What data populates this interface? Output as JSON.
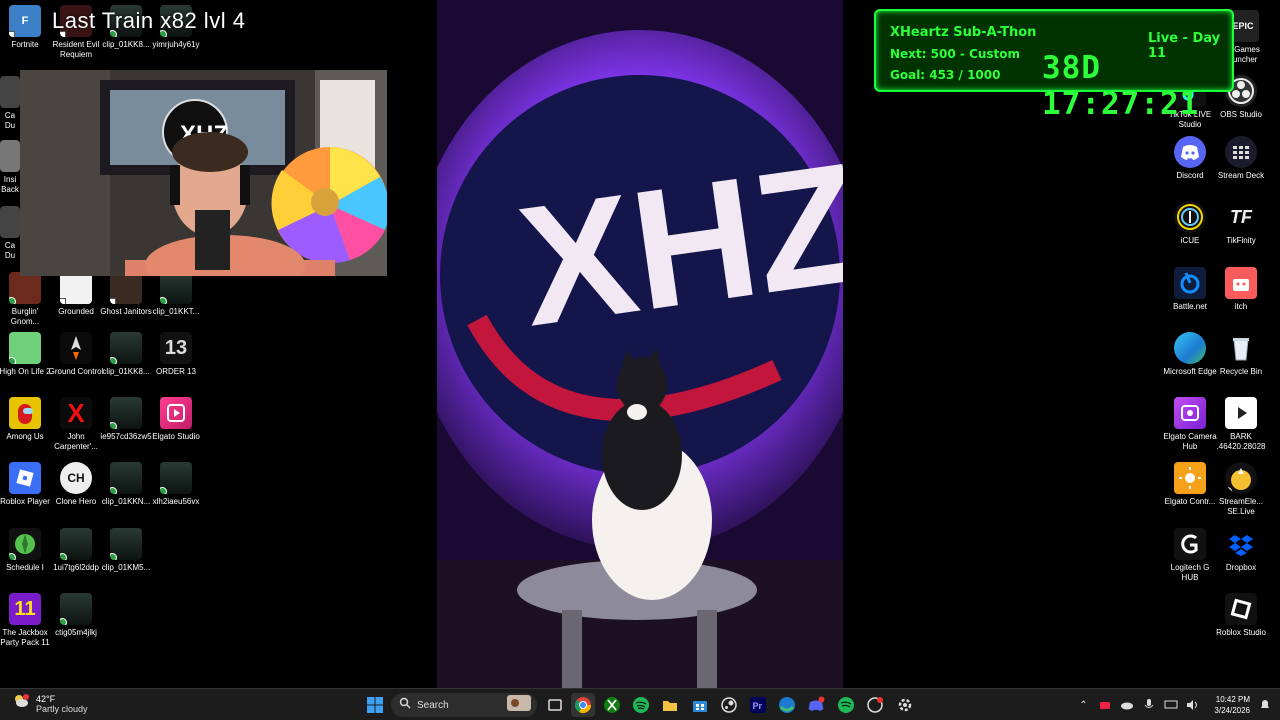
{
  "overlay": {
    "game_title": "Last Train   x82   lvl 4"
  },
  "subathon": {
    "title": "XHeartz Sub-A-Thon",
    "next": "Next: 500 - Custom Hea",
    "goal": "Goal: 453 / 1000",
    "day": "Live - Day 11",
    "timer": "38D  17:27:21",
    "color": "#2dff3a"
  },
  "desktop_left": [
    {
      "label": "Fortnite",
      "icon": "fortnite-icon"
    },
    {
      "label": "Resident Evil Requiem",
      "icon": "game-icon"
    },
    {
      "label": "clip_01KK8...",
      "icon": "clip-icon"
    },
    {
      "label": "yimrjuh4y61y",
      "icon": "clip-icon"
    },
    {
      "label": "Burglin' Gnom...",
      "icon": "game-icon"
    },
    {
      "label": "Grounded",
      "icon": "game-icon"
    },
    {
      "label": "Ghost Janitors",
      "icon": "game-icon"
    },
    {
      "label": "clip_01KKT...",
      "icon": "clip-icon"
    },
    {
      "label": "High On Life 2",
      "icon": "game-icon"
    },
    {
      "label": "Ground Control",
      "icon": "rocket-icon"
    },
    {
      "label": "clip_01KK8...",
      "icon": "clip-icon"
    },
    {
      "label": "ORDER 13",
      "icon": "game-icon"
    },
    {
      "label": "Among Us",
      "icon": "among-us-icon"
    },
    {
      "label": "John Carpenter'...",
      "icon": "game-icon"
    },
    {
      "label": "ie957cd36zw5",
      "icon": "clip-icon"
    },
    {
      "label": "Elgato Studio",
      "icon": "elgato-icon"
    },
    {
      "label": "Roblox Player",
      "icon": "roblox-icon"
    },
    {
      "label": "Clone Hero",
      "icon": "clone-hero-icon"
    },
    {
      "label": "clip_01KKN...",
      "icon": "clip-icon"
    },
    {
      "label": "xlh2iaeu56vx",
      "icon": "clip-icon"
    },
    {
      "label": "Schedule I",
      "icon": "game-icon"
    },
    {
      "label": "1ui7tg6l2ddp",
      "icon": "clip-icon"
    },
    {
      "label": "clip_01KM5...",
      "icon": "clip-icon"
    },
    {
      "label": "The Jackbox Party Pack 11",
      "icon": "jackbox-icon"
    },
    {
      "label": "ctig05m4jlkj",
      "icon": "clip-icon"
    }
  ],
  "desktop_left_partial": [
    {
      "label": "Ca Du"
    },
    {
      "label": "Insi Back"
    },
    {
      "label": "Ca Du"
    }
  ],
  "desktop_right": [
    {
      "label": "ic Games auncher",
      "icon": "epic-games-icon"
    },
    {
      "label": "TikTok LIVE Studio",
      "icon": "tiktok-icon"
    },
    {
      "label": "OBS Studio",
      "icon": "obs-icon"
    },
    {
      "label": "Discord",
      "icon": "discord-icon"
    },
    {
      "label": "Stream Deck",
      "icon": "stream-deck-icon"
    },
    {
      "label": "iCUE",
      "icon": "icue-icon"
    },
    {
      "label": "TikFinity",
      "icon": "tikfinity-icon"
    },
    {
      "label": "Battle.net",
      "icon": "battlenet-icon"
    },
    {
      "label": "itch",
      "icon": "itch-icon"
    },
    {
      "label": "Microsoft Edge",
      "icon": "edge-icon"
    },
    {
      "label": "Recycle Bin",
      "icon": "recycle-bin-icon"
    },
    {
      "label": "Elgato Camera Hub",
      "icon": "elgato-camera-icon"
    },
    {
      "label": "BARK .46420.28028",
      "icon": "media-icon"
    },
    {
      "label": "Elgato Contr...",
      "icon": "elgato-control-icon"
    },
    {
      "label": "StreamEle... SE.Live",
      "icon": "streamelements-icon"
    },
    {
      "label": "Logitech G HUB",
      "icon": "logitech-icon"
    },
    {
      "label": "Dropbox",
      "icon": "dropbox-icon"
    },
    {
      "label": "Roblox Studio",
      "icon": "roblox-studio-icon"
    }
  ],
  "taskbar": {
    "weather_temp": "42°F",
    "weather_cond": "Partly cloudy",
    "search_placeholder": "Search",
    "time": "10:42 PM",
    "date": "3/24/2026"
  }
}
